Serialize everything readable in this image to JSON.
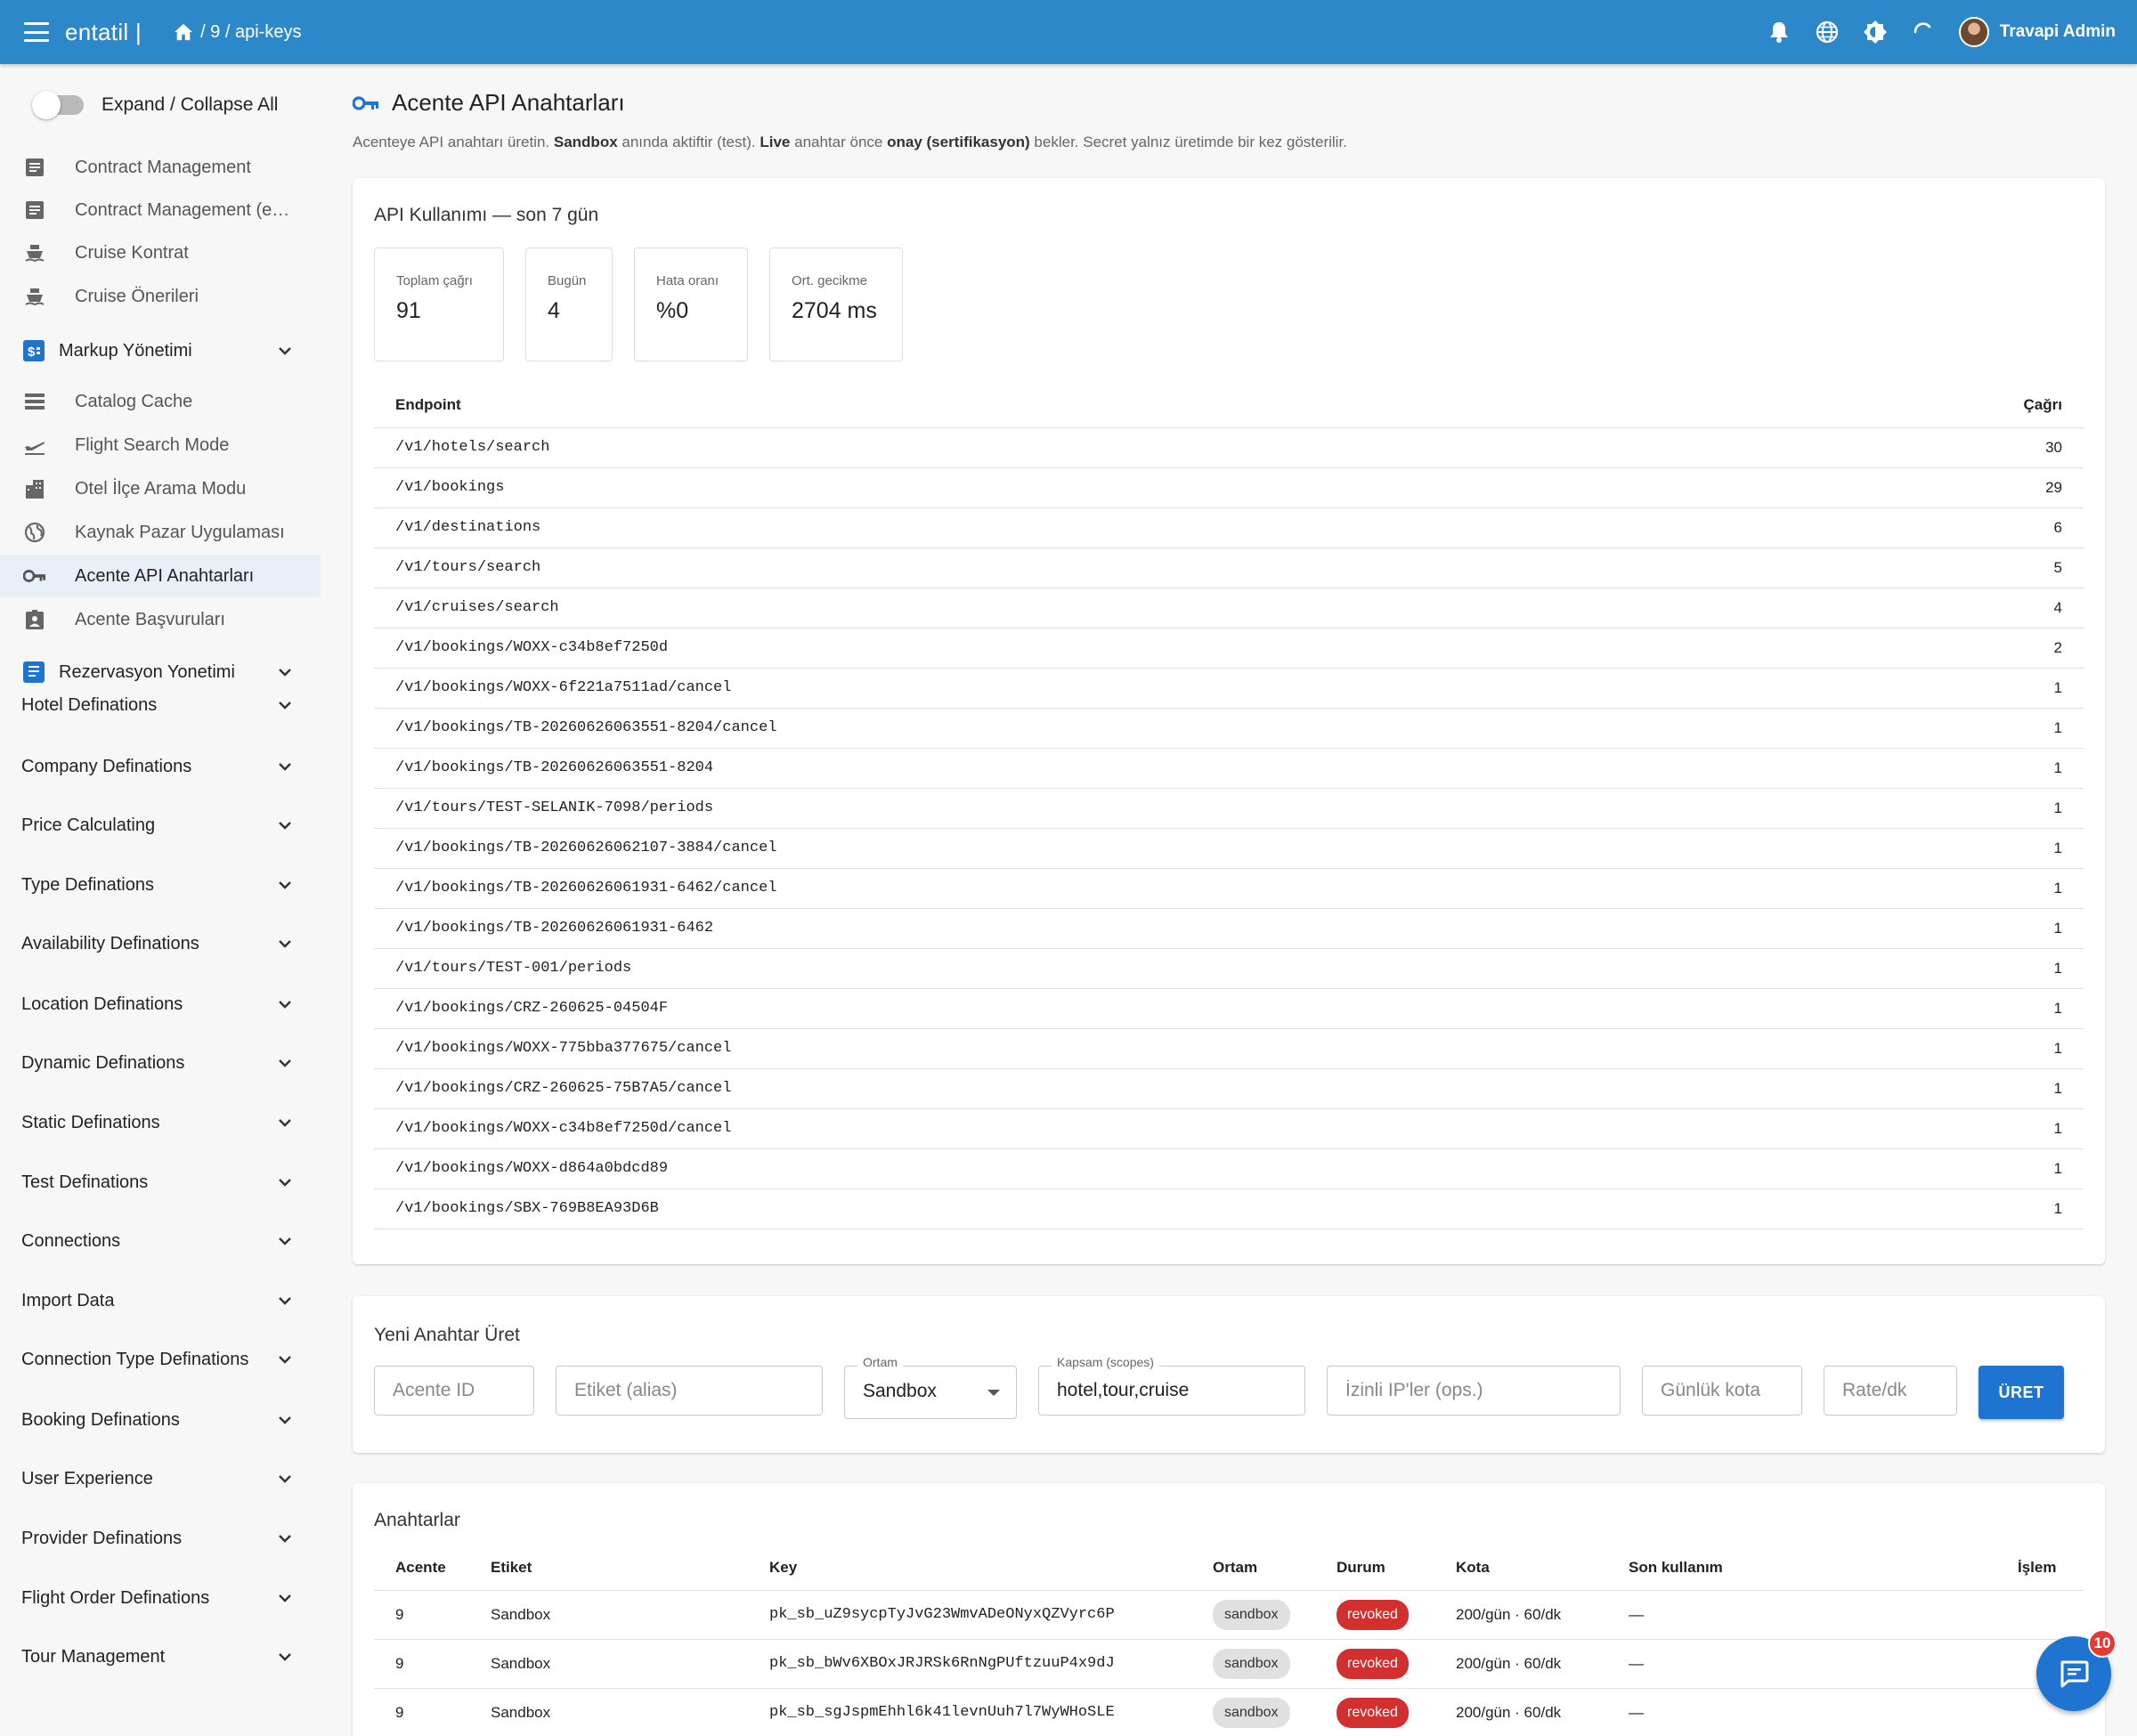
{
  "appbar": {
    "brand": "entatil |",
    "breadcrumb": [
      "/ 9 / api-keys"
    ],
    "user_name": "Travapi Admin"
  },
  "sidebar": {
    "expand_label": "Expand / Collapse All",
    "items": [
      {
        "label": "Contract Management",
        "icon": "document-icon"
      },
      {
        "label": "Contract Management (e…",
        "icon": "document-icon"
      },
      {
        "label": "Cruise Kontrat",
        "icon": "ship-icon"
      },
      {
        "label": "Cruise Önerileri",
        "icon": "ship-icon"
      },
      {
        "label": "Catalog Cache",
        "icon": "storage-icon"
      },
      {
        "label": "Flight Search Mode",
        "icon": "flight-takeoff-icon"
      },
      {
        "label": "Otel İlçe Arama Modu",
        "icon": "city-icon"
      },
      {
        "label": "Kaynak Pazar Uygulaması",
        "icon": "globe-icon"
      },
      {
        "label": "Acente API Anahtarları",
        "icon": "key-icon"
      },
      {
        "label": "Acente Başvuruları",
        "icon": "badge-icon"
      }
    ],
    "markup_group": "Markup Yönetimi",
    "reservation_group": "Rezervasyon Yonetimi",
    "groups": [
      "Hotel Definations",
      "Company Definations",
      "Price Calculating",
      "Type Definations",
      "Availability Definations",
      "Location Definations",
      "Dynamic Definations",
      "Static Definations",
      "Test Definations",
      "Connections",
      "Import Data",
      "Connection Type Definations",
      "Booking Definations",
      "User Experience",
      "Provider Definations",
      "Flight Order Definations",
      "Tour Management"
    ]
  },
  "page": {
    "title": "Acente API Anahtarları",
    "desc_1": "Acenteye API anahtarı üretin. ",
    "desc_sandbox": "Sandbox",
    "desc_2": " anında aktiftir (test). ",
    "desc_live": "Live",
    "desc_3": " anahtar önce ",
    "desc_onay": "onay (sertifikasyon)",
    "desc_4": " bekler. Secret yalnız üretimde bir kez gösterilir."
  },
  "usage": {
    "title": "API Kullanımı — son 7 gün",
    "stats": [
      {
        "label": "Toplam çağrı",
        "value": "91"
      },
      {
        "label": "Bugün",
        "value": "4"
      },
      {
        "label": "Hata oranı",
        "value": "%0"
      },
      {
        "label": "Ort. gecikme",
        "value": "2704 ms"
      }
    ],
    "col_endpoint": "Endpoint",
    "col_calls": "Çağrı",
    "rows": [
      [
        "/v1/hotels/search",
        "30"
      ],
      [
        "/v1/bookings",
        "29"
      ],
      [
        "/v1/destinations",
        "6"
      ],
      [
        "/v1/tours/search",
        "5"
      ],
      [
        "/v1/cruises/search",
        "4"
      ],
      [
        "/v1/bookings/WOXX-c34b8ef7250d",
        "2"
      ],
      [
        "/v1/bookings/WOXX-6f221a7511ad/cancel",
        "1"
      ],
      [
        "/v1/bookings/TB-20260626063551-8204/cancel",
        "1"
      ],
      [
        "/v1/bookings/TB-20260626063551-8204",
        "1"
      ],
      [
        "/v1/tours/TEST-SELANIK-7098/periods",
        "1"
      ],
      [
        "/v1/bookings/TB-20260626062107-3884/cancel",
        "1"
      ],
      [
        "/v1/bookings/TB-20260626061931-6462/cancel",
        "1"
      ],
      [
        "/v1/bookings/TB-20260626061931-6462",
        "1"
      ],
      [
        "/v1/tours/TEST-001/periods",
        "1"
      ],
      [
        "/v1/bookings/CRZ-260625-04504F",
        "1"
      ],
      [
        "/v1/bookings/WOXX-775bba377675/cancel",
        "1"
      ],
      [
        "/v1/bookings/CRZ-260625-75B7A5/cancel",
        "1"
      ],
      [
        "/v1/bookings/WOXX-c34b8ef7250d/cancel",
        "1"
      ],
      [
        "/v1/bookings/WOXX-d864a0bdcd89",
        "1"
      ],
      [
        "/v1/bookings/SBX-769B8EA93D6B",
        "1"
      ]
    ]
  },
  "form": {
    "title": "Yeni Anahtar Üret",
    "agency_placeholder": "Acente ID",
    "alias_placeholder": "Etiket (alias)",
    "env_label": "Ortam",
    "env_value": "Sandbox",
    "scopes_label": "Kapsam (scopes)",
    "scopes_value": "hotel,tour,cruise",
    "ips_placeholder": "İzinli IP'ler (ops.)",
    "daily_placeholder": "Günlük kota",
    "rate_placeholder": "Rate/dk",
    "submit_label": "ÜRET"
  },
  "keys": {
    "title": "Anahtarlar",
    "columns": [
      "Acente",
      "Etiket",
      "Key",
      "Ortam",
      "Durum",
      "Kota",
      "Son kullanım",
      "İşlem"
    ],
    "rows": [
      {
        "agency": "9",
        "label": "Sandbox",
        "key": "pk_sb_uZ9sycpTyJvG23WmvADeONyxQZVyrc6P",
        "env": "sandbox",
        "status": "revoked",
        "quota": "200/gün · 60/dk",
        "last_used": "—"
      },
      {
        "agency": "9",
        "label": "Sandbox",
        "key": "pk_sb_bWv6XBOxJRJRSk6RnNgPUftzuuP4x9dJ",
        "env": "sandbox",
        "status": "revoked",
        "quota": "200/gün · 60/dk",
        "last_used": "—"
      },
      {
        "agency": "9",
        "label": "Sandbox",
        "key": "pk_sb_sgJspmEhhl6k41levnUuh7l7WyWHoSLE",
        "env": "sandbox",
        "status": "revoked",
        "quota": "200/gün · 60/dk",
        "last_used": "—"
      }
    ]
  },
  "chat": {
    "badge": "10"
  },
  "colors": {
    "appbar": "#2c88c8",
    "primary": "#1f74d1",
    "revoked": "#d32f2f",
    "active_item_bg": "#e8eff7"
  }
}
